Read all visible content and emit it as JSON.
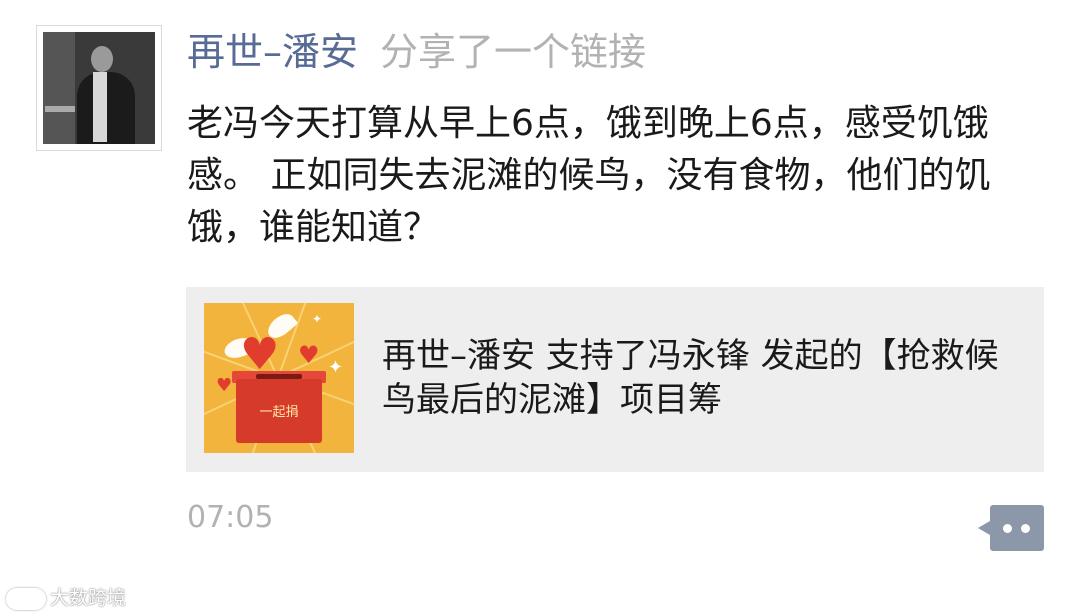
{
  "post": {
    "nickname": "再世–潘安",
    "action": "分享了一个链接",
    "text": "老冯今天打算从早上6点，饿到晚上6点，感受饥饿感。 正如同失去泥滩的候鸟，没有食物，他们的饥饿，谁能知道？",
    "time": "07:05"
  },
  "link_card": {
    "title": "再世–潘安 支持了冯永锋 发起的【抢救候鸟最后的泥滩】项目筹",
    "thumbnail_label": "一起捐"
  },
  "watermark": {
    "text": "大数跨境"
  },
  "colors": {
    "nickname": "#576b95",
    "secondary_text": "#b2b2b2",
    "card_background": "#eeeeee",
    "comment_button": "#8c97aa"
  }
}
